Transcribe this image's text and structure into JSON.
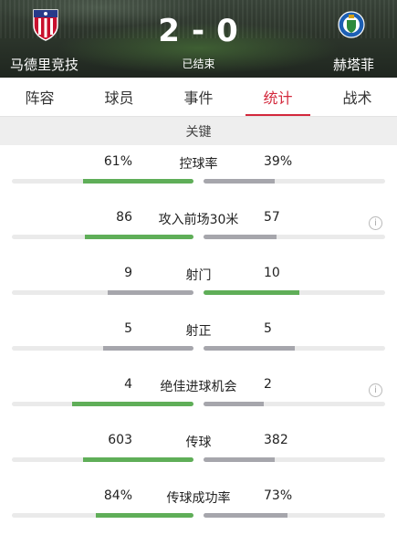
{
  "header": {
    "home_team": "马德里竞技",
    "away_team": "赫塔菲",
    "home_score": "2",
    "separator": "-",
    "away_score": "0",
    "status": "已结束",
    "home_icon": "atletico-madrid-crest",
    "away_icon": "getafe-crest"
  },
  "tabs": [
    {
      "label": "阵容"
    },
    {
      "label": "球员"
    },
    {
      "label": "事件"
    },
    {
      "label": "统计",
      "active": true
    },
    {
      "label": "战术"
    }
  ],
  "section_title": "关键",
  "colors": {
    "leader": "#5fae58",
    "other": "#a6a6ac",
    "accent": "#d3283c"
  },
  "stats": [
    {
      "label": "控球率",
      "home": "61%",
      "away": "39%",
      "home_frac": 0.61,
      "away_frac": 0.39,
      "info": false
    },
    {
      "label": "攻入前场30米",
      "home": "86",
      "away": "57",
      "home_frac": 0.6,
      "away_frac": 0.4,
      "info": true
    },
    {
      "label": "射门",
      "home": "9",
      "away": "10",
      "home_frac": 0.47,
      "away_frac": 0.53,
      "info": false
    },
    {
      "label": "射正",
      "home": "5",
      "away": "5",
      "home_frac": 0.5,
      "away_frac": 0.5,
      "info": false
    },
    {
      "label": "绝佳进球机会",
      "home": "4",
      "away": "2",
      "home_frac": 0.67,
      "away_frac": 0.33,
      "info": true
    },
    {
      "label": "传球",
      "home": "603",
      "away": "382",
      "home_frac": 0.61,
      "away_frac": 0.39,
      "info": false
    },
    {
      "label": "传球成功率",
      "home": "84%",
      "away": "73%",
      "home_frac": 0.54,
      "away_frac": 0.46,
      "info": false
    }
  ]
}
